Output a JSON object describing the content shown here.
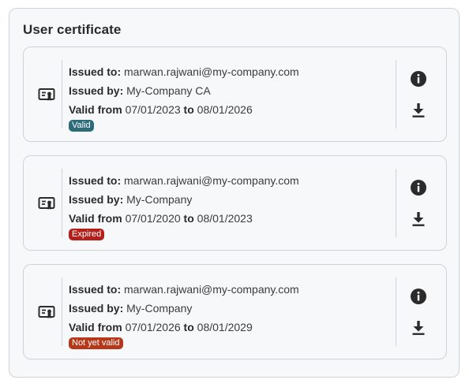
{
  "panel": {
    "title": "User certificate"
  },
  "labels": {
    "issued_to": "Issued to:",
    "issued_by": "Issued by:",
    "valid_from": "Valid from",
    "to": "to"
  },
  "certificates": [
    {
      "issued_to": "marwan.rajwani@my-company.com",
      "issued_by": "My-Company CA",
      "valid_from": "07/01/2023",
      "valid_to": "08/01/2026",
      "status": "Valid",
      "status_color": "#2e6b7a"
    },
    {
      "issued_to": "marwan.rajwani@my-company.com",
      "issued_by": "My-Company",
      "valid_from": "07/01/2020",
      "valid_to": "08/01/2023",
      "status": "Expired",
      "status_color": "#b3201c"
    },
    {
      "issued_to": "marwan.rajwani@my-company.com",
      "issued_by": "My-Company",
      "valid_from": "07/01/2026",
      "valid_to": "08/01/2029",
      "status": "Not yet valid",
      "status_color": "#b5381a"
    }
  ],
  "icons": {
    "certificate": "certificate-icon",
    "info": "info-icon",
    "download": "download-icon"
  }
}
